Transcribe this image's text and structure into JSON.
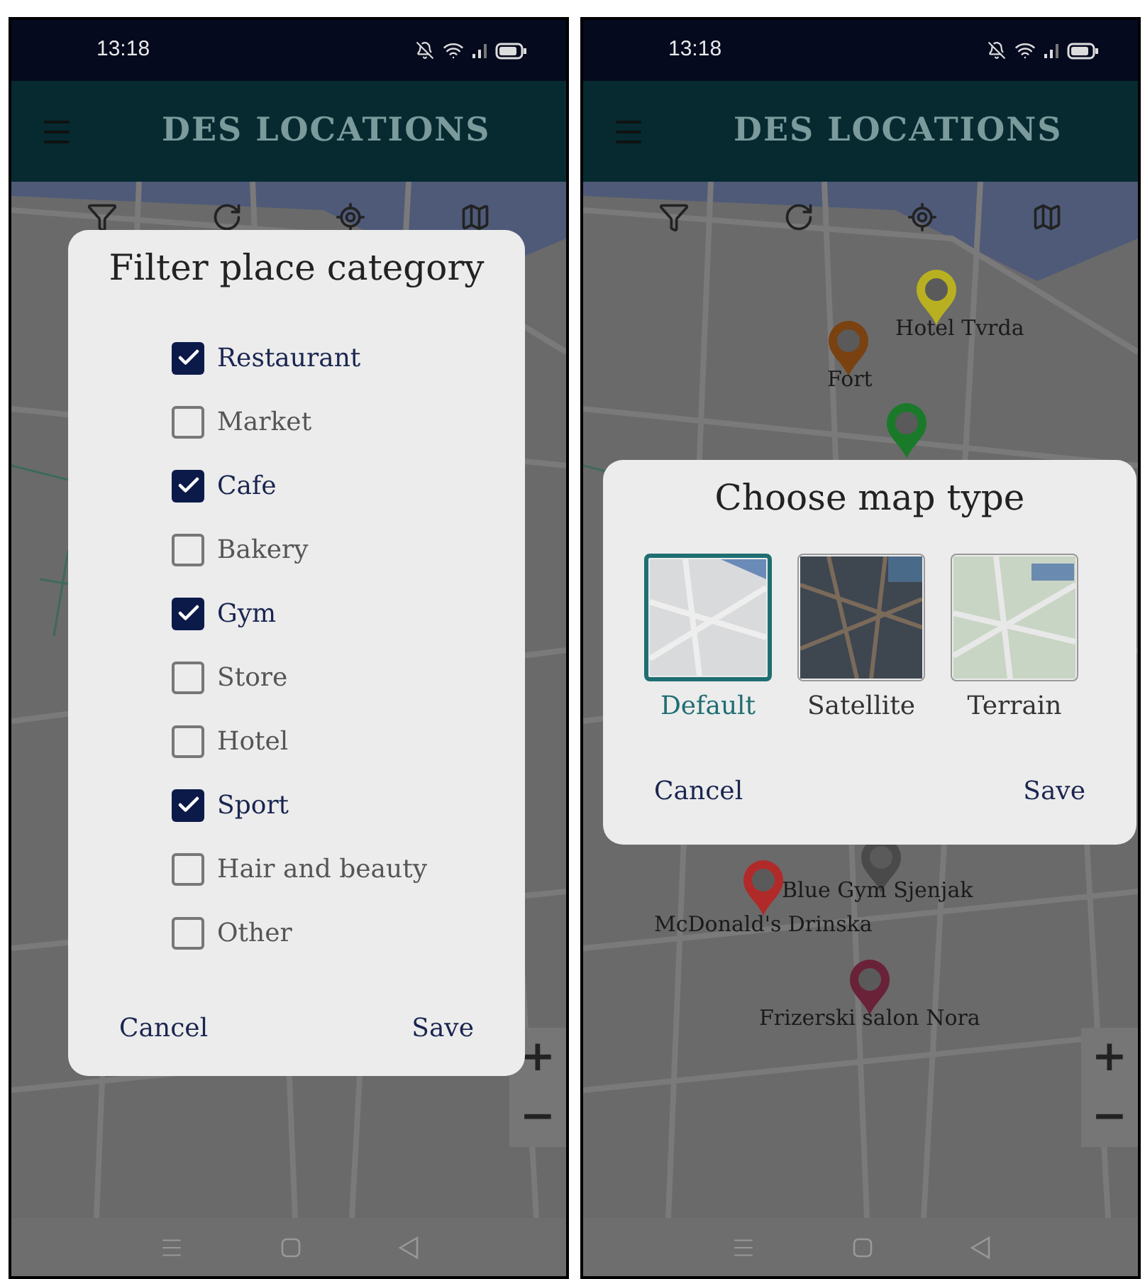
{
  "screens": [
    {
      "status_bar": {
        "time": "13:18"
      },
      "app_bar": {
        "title": "DES LOCATIONS"
      },
      "map": {
        "zoom_in": "+",
        "zoom_out": "−"
      },
      "dialog": {
        "kind": "category_filter",
        "title": "Filter place category",
        "options": [
          {
            "label": "Restaurant",
            "checked": true
          },
          {
            "label": "Market",
            "checked": false
          },
          {
            "label": "Cafe",
            "checked": true
          },
          {
            "label": "Bakery",
            "checked": false
          },
          {
            "label": "Gym",
            "checked": true
          },
          {
            "label": "Store",
            "checked": false
          },
          {
            "label": "Hotel",
            "checked": false
          },
          {
            "label": "Sport",
            "checked": true
          },
          {
            "label": "Hair and beauty",
            "checked": false
          },
          {
            "label": "Other",
            "checked": false
          }
        ],
        "cancel": "Cancel",
        "save": "Save"
      }
    },
    {
      "status_bar": {
        "time": "13:18"
      },
      "app_bar": {
        "title": "DES LOCATIONS"
      },
      "map": {
        "markers": [
          {
            "label": "Hotel Tvrda",
            "color": "#b8b020"
          },
          {
            "label": "Fort",
            "color": "#7a4210"
          },
          {
            "color": "#1a7a2a"
          },
          {
            "label": "McDonald's Drinska",
            "color": "#b02a2a"
          },
          {
            "label": "Blue Gym Sjenjak",
            "color": "#4a4a4a"
          },
          {
            "label": "Frizerski salon Nora",
            "color": "#6a2238"
          }
        ],
        "zoom_in": "+",
        "zoom_out": "−"
      },
      "dialog": {
        "kind": "map_type",
        "title": "Choose map type",
        "options": [
          {
            "label": "Default",
            "selected": true,
            "kind": "default"
          },
          {
            "label": "Satellite",
            "selected": false,
            "kind": "satellite"
          },
          {
            "label": "Terrain",
            "selected": false,
            "kind": "terrain"
          }
        ],
        "cancel": "Cancel",
        "save": "Save"
      }
    }
  ]
}
